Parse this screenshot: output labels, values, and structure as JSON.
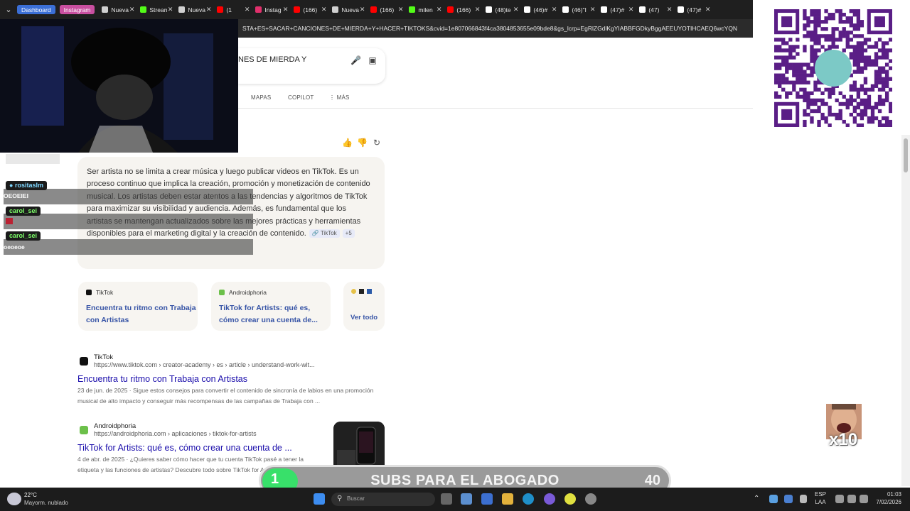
{
  "tabs": {
    "groups": [
      {
        "label": "Dashboard",
        "color": "#3b6fd6"
      },
      {
        "label": "Instagram",
        "color": "#c94fa0"
      }
    ],
    "items": [
      {
        "label": "Nueva",
        "color": "#d0d0d0"
      },
      {
        "label": "Strean",
        "color": "#53fc18"
      },
      {
        "label": "Nueva",
        "color": "#d0d0d0"
      },
      {
        "label": "(1",
        "color": "#ff0000"
      },
      {
        "label": "Instag",
        "color": "#e1306c"
      },
      {
        "label": "(166)",
        "color": "#ff0000"
      },
      {
        "label": "Nueva",
        "color": "#d0d0d0"
      },
      {
        "label": "(166)",
        "color": "#ff0000"
      },
      {
        "label": "milen",
        "color": "#53fc18"
      },
      {
        "label": "(166)",
        "color": "#ff0000"
      },
      {
        "label": "(48)te",
        "color": "#ffffff"
      },
      {
        "label": "(46)#",
        "color": "#ffffff"
      },
      {
        "label": "(46)\"I",
        "color": "#ffffff"
      },
      {
        "label": "(47)#",
        "color": "#ffffff"
      },
      {
        "label": "(47)",
        "color": "#ffffff"
      },
      {
        "label": "(47)#",
        "color": "#ffffff"
      }
    ]
  },
  "address_bar": {
    "text": "STA+ES+SACAR+CANCIONES+DE+MIERDA+Y+HACER+TIKTOKS&cvid=1e807066843f4ca3804853655e09bde8&gs_lcrp=EgRlZGdlKgYIABBFGDkyBggAEEUYOTIHCAEQ6wcYQN"
  },
  "search": {
    "query": "NES DE MIERDA Y"
  },
  "nav": {
    "maps": "MAPAS",
    "copilot": "COPILOT",
    "more": "MÁS"
  },
  "answer": {
    "text": "Ser artista no se limita a crear música y luego publicar videos en TikTok. Es un proceso continuo que implica la creación, promoción y monetización de contenido musical. Los artistas deben estar atentos a las tendencias y algoritmos de TikTok para maximizar su visibilidad y audiencia. Además, es fundamental que los artistas se mantengan actualizados sobre las mejores prácticas y herramientas disponibles para el marketing digital y la creación de contenido.",
    "citation": "TikTok",
    "more": "+5"
  },
  "cards": [
    {
      "source": "TikTok",
      "title": "Encuentra tu ritmo con Trabaja con Artistas",
      "icon_color": "#111111"
    },
    {
      "source": "Androidphoria",
      "title": "TikTok for Artists: qué es, cómo crear una cuenta de...",
      "icon_color": "#6cc04a"
    }
  ],
  "see_all": "Ver todo",
  "results": [
    {
      "site": "TikTok",
      "url": "https://www.tiktok.com › creator-academy › es › article › understand-work-wit...",
      "title": "Encuentra tu ritmo con Trabaja con Artistas",
      "snippet": "23 de jun. de 2025 · Sigue estos consejos para convertir el contenido de sincronía de labios en una promoción musical de alto impacto y conseguir más recompensas de las campañas de Trabaja con ...",
      "icon_color": "#111111"
    },
    {
      "site": "Androidphoria",
      "url": "https://androidphoria.com › aplicaciones › tiktok-for-artists",
      "title": "TikTok for Artists: qué es, cómo crear una cuenta de ...",
      "snippet": "4 de abr. de 2025 · ¿Quieres saber cómo hacer que tu cuenta TikTok pasé a tener la etiqueta y las funciones de artistas? Descubre todo sobre TikTok for Artists.",
      "icon_color": "#6cc04a"
    }
  ],
  "chat": [
    {
      "user": "rositaslm",
      "message": "OEOEIEI"
    },
    {
      "user": "carol_sei",
      "message": ""
    },
    {
      "user": "carol_sei",
      "message": "oeoeoe"
    }
  ],
  "emote": {
    "multiplier": "x10"
  },
  "goal": {
    "current": "1",
    "label": "SUBS PARA EL ABOGADO",
    "target": "40",
    "progress": 0.025
  },
  "taskbar": {
    "temp": "22°C",
    "weather": "Mayorm. nublado",
    "search_placeholder": "Buscar",
    "lang": "ESP",
    "region": "LAA",
    "time": "01:03",
    "date": "7/02/2026"
  }
}
